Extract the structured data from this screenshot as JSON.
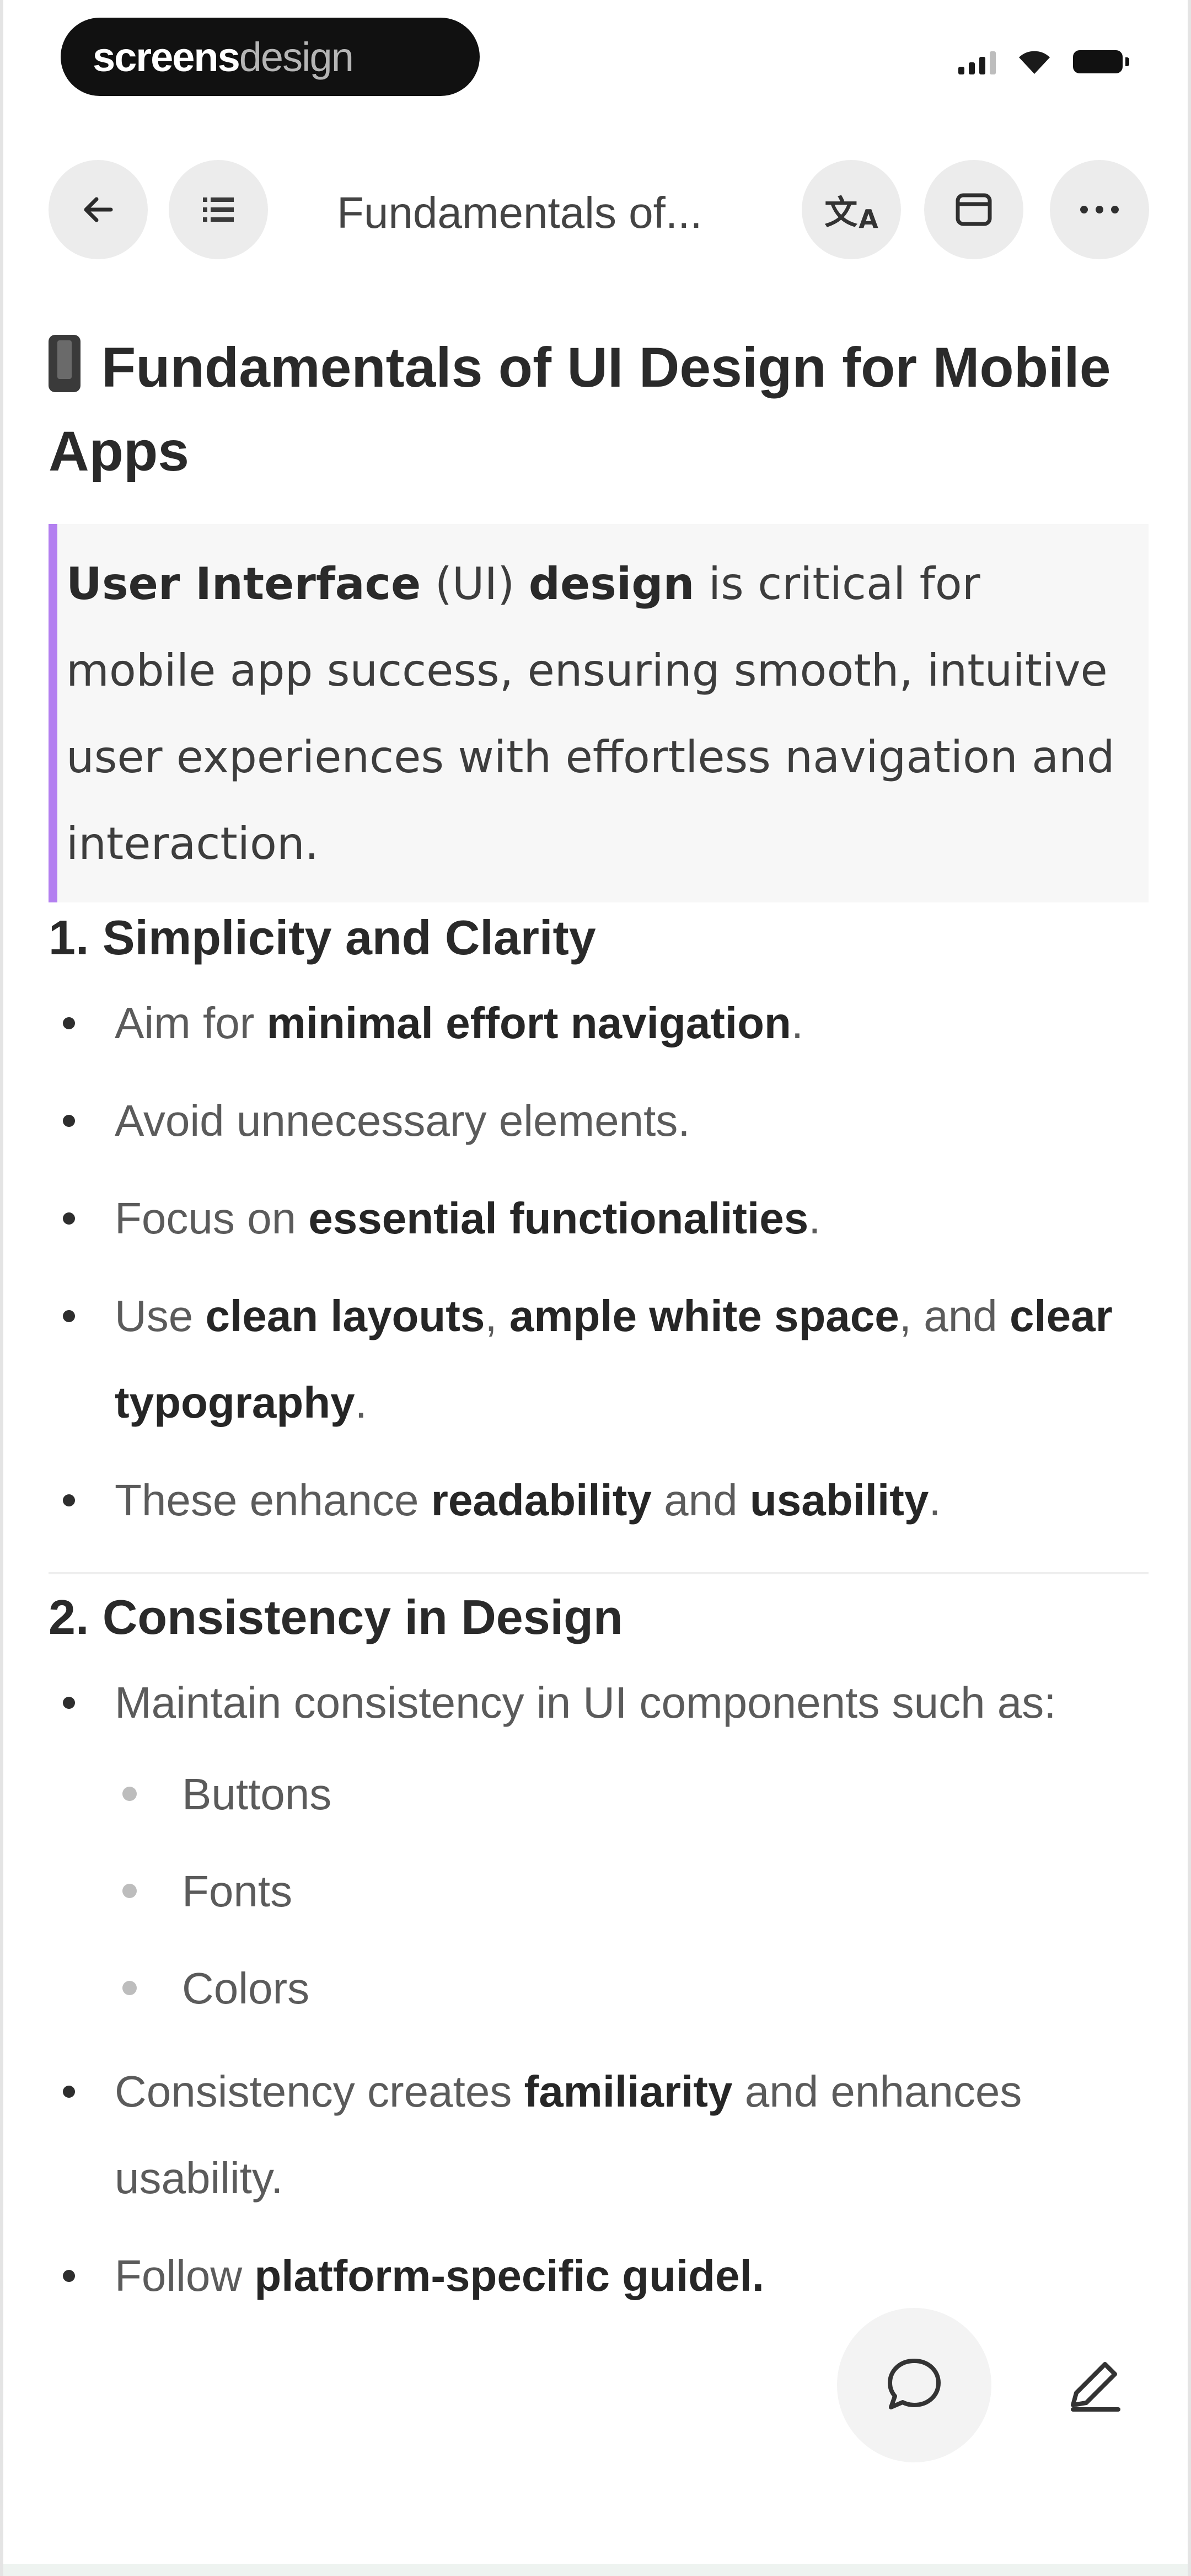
{
  "status_bar": {
    "brand_part1": "screens",
    "brand_part2": "design"
  },
  "nav": {
    "title": "Fundamentals of...",
    "icons": [
      "back-arrow-icon",
      "outline-list-icon",
      "translate-icon",
      "browser-window-icon",
      "more-icon"
    ]
  },
  "page": {
    "title": "Fundamentals of UI Design for Mobile Apps",
    "title_emoji": "mobile-phone-icon"
  },
  "callout": {
    "term1": "User Interface",
    "mid1": " (UI) ",
    "term2": "design",
    "rest": " is critical for mobile app success, ensuring smooth, intuitive user experiences with effortless navigation and interaction.",
    "accent_color": "#b37ff0"
  },
  "section1": {
    "heading": "1. Simplicity and Clarity",
    "b1": {
      "t1": "Aim for ",
      "s1": "minimal effort navigation",
      "t2": "."
    },
    "b2": {
      "t1": "Avoid unnecessary elements."
    },
    "b3": {
      "t1": "Focus on ",
      "s1": "essential functionalities",
      "t2": "."
    },
    "b4": {
      "t1": "Use ",
      "s1": "clean layouts",
      "t2": ", ",
      "s2": "ample white space",
      "t3": ", and ",
      "s3": "clear typography",
      "t4": "."
    },
    "b5": {
      "t1": "These enhance ",
      "s1": "readability",
      "t2": " and ",
      "s2": "usability",
      "t3": "."
    }
  },
  "section2": {
    "heading": "2. Consistency in Design",
    "b1": {
      "t1": "Maintain consistency in UI components such as:"
    },
    "sub": [
      "Buttons",
      "Fonts",
      "Colors"
    ],
    "b2": {
      "t1": "Consistency creates ",
      "s1": "familiarity",
      "t2": " and enhances usability."
    },
    "b3": {
      "t1": "Follow ",
      "s1": "platform-specific guidel."
    }
  },
  "actions": {
    "comment_icon": "comment-bubble-icon",
    "edit_icon": "pencil-edit-icon"
  }
}
